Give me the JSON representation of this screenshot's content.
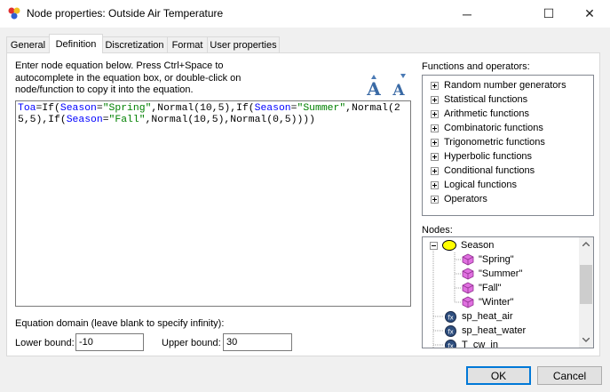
{
  "window": {
    "title": "Node properties: Outside Air Temperature",
    "icon": "app-icon",
    "controls": {
      "minimize": "─",
      "maximize": "☐",
      "close": "✕"
    }
  },
  "tabs": [
    {
      "label": "General"
    },
    {
      "label": "Definition",
      "active": true
    },
    {
      "label": "Discretization"
    },
    {
      "label": "Format"
    },
    {
      "label": "User properties"
    }
  ],
  "definition": {
    "instructions": "Enter node equation below. Press Ctrl+Space to autocomplete in the equation box, or double-click on node/function to copy it into the equation.",
    "font_buttons": {
      "increase": "A",
      "decrease": "A"
    },
    "equation_tokens": [
      {
        "t": "Toa",
        "k": "id"
      },
      {
        "t": "=If(",
        "k": "plain"
      },
      {
        "t": "Season",
        "k": "id"
      },
      {
        "t": "=",
        "k": "plain"
      },
      {
        "t": "\"Spring\"",
        "k": "str"
      },
      {
        "t": ",Normal(10,5),If(",
        "k": "plain"
      },
      {
        "t": "Season",
        "k": "id"
      },
      {
        "t": "=",
        "k": "plain"
      },
      {
        "t": "\"Summer\"",
        "k": "str"
      },
      {
        "t": ",Normal(25,5),If(",
        "k": "plain"
      },
      {
        "t": "Season",
        "k": "id"
      },
      {
        "t": "=",
        "k": "plain"
      },
      {
        "t": "\"Fall\"",
        "k": "str"
      },
      {
        "t": ",Normal(10,5),Normal(0,5))))",
        "k": "plain"
      }
    ],
    "functions_label": "Functions and operators:",
    "functions": [
      "Random number generators",
      "Statistical functions",
      "Arithmetic functions",
      "Combinatoric functions",
      "Trigonometric functions",
      "Hyperbolic functions",
      "Conditional functions",
      "Logical functions",
      "Operators"
    ],
    "nodes_label": "Nodes:",
    "nodes": [
      {
        "label": "Season",
        "kind": "chance-node",
        "expanded": true,
        "level": 0
      },
      {
        "label": "\"Spring\"",
        "kind": "state",
        "level": 1
      },
      {
        "label": "\"Summer\"",
        "kind": "state",
        "level": 1
      },
      {
        "label": "\"Fall\"",
        "kind": "state",
        "level": 1
      },
      {
        "label": "\"Winter\"",
        "kind": "state",
        "level": 1
      },
      {
        "label": "sp_heat_air",
        "kind": "equation-node",
        "level": 0
      },
      {
        "label": "sp_heat_water",
        "kind": "equation-node",
        "level": 0
      },
      {
        "label": "T_cw_in",
        "kind": "equation-node",
        "level": 0
      }
    ],
    "domain_label": "Equation domain (leave blank to specify infinity):",
    "lower_label": "Lower bound:",
    "lower_value": "-10",
    "upper_label": "Upper bound:",
    "upper_value": "30"
  },
  "buttons": {
    "ok": "OK",
    "cancel": "Cancel"
  }
}
